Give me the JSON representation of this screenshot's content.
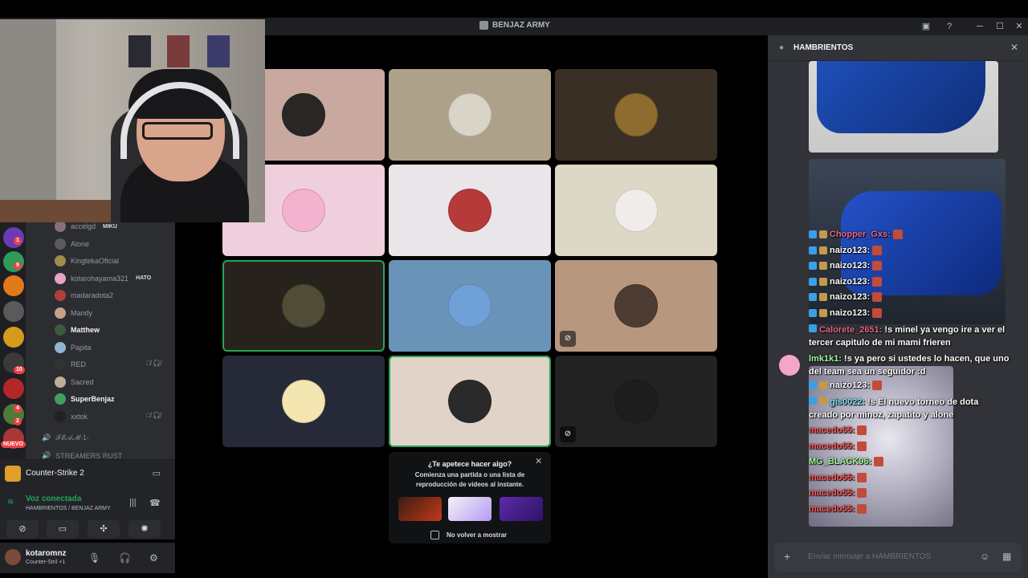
{
  "window": {
    "title": "BENJAZ ARMY"
  },
  "members": [
    {
      "name": "accelgd",
      "tag": "MIKU",
      "color": "#8a6f7a"
    },
    {
      "name": "Alone",
      "tag": "",
      "color": "#5b5b5b"
    },
    {
      "name": "KingtekaOficial",
      "tag": "",
      "color": "#a08a50"
    },
    {
      "name": "kotarohayama321",
      "tag": "HATO",
      "color": "#e7a3c4"
    },
    {
      "name": "madaradota2",
      "tag": "",
      "color": "#b0403a"
    },
    {
      "name": "Mandy",
      "tag": "",
      "color": "#c7a18a"
    },
    {
      "name": "Matthew",
      "tag": "",
      "color": "#3d5a3f"
    },
    {
      "name": "Papita",
      "tag": "",
      "color": "#8fb4d4"
    },
    {
      "name": "RED",
      "tag": "",
      "color": "#333"
    },
    {
      "name": "Sacred",
      "tag": "",
      "color": "#c2ad98"
    },
    {
      "name": "SuperBenjaz",
      "tag": "",
      "color": "#40a060"
    },
    {
      "name": "xxtok",
      "tag": "",
      "color": "#222"
    }
  ],
  "voice_channels": [
    "𝓣𝓔𝓐𝓜-1-",
    "STREAMERS RUST"
  ],
  "rail_badges": [
    "1",
    "9",
    "10",
    "4",
    "2"
  ],
  "nuevo": "NUEVO",
  "activity": {
    "game": "Counter-Strike 2"
  },
  "voice": {
    "status": "Voz conectada",
    "channel": "HAMBRIENTOS / BENJAZ ARMY"
  },
  "user": {
    "name": "kotaromnz",
    "status": "Counter-Stril +1"
  },
  "tiles_colors": [
    "#c9a8a0",
    "#aea189",
    "#3a2f25",
    "#efcfdc",
    "#e9e5e8",
    "#dcd8c5",
    "#27231c",
    "#6a93b8",
    "#b7987e",
    "#262938",
    "#e1d3c7",
    "#222222"
  ],
  "avatar_colors": [
    "#2a2626",
    "#d9d4c8",
    "#8e6b2f",
    "#f3b3cf",
    "#b53a3a",
    "#f0ecea",
    "#4f4d35",
    "#6fa0d8",
    "#4d3c33",
    "#f4e6b0",
    "#2a2a2a",
    "#1d1d1d"
  ],
  "promo": {
    "title": "¿Te apetece hacer algo?",
    "subtitle": "Comienza una partida o una lista de reproducción de vídeos al instante.",
    "checkbox": "No volver a mostrar"
  },
  "chat": {
    "title": "HAMBRIENTOS",
    "placeholder": "Enviar mensaje a HAMBRIENTOS",
    "overlay": [
      {
        "name": "Chopper_Gxs:",
        "cls": "n1",
        "text": ""
      },
      {
        "name": "naizo123:",
        "cls": "",
        "text": ""
      },
      {
        "name": "naizo123:",
        "cls": "",
        "text": ""
      },
      {
        "name": "naizo123:",
        "cls": "",
        "text": ""
      },
      {
        "name": "naizo123:",
        "cls": "",
        "text": ""
      },
      {
        "name": "naizo123:",
        "cls": "",
        "text": ""
      }
    ],
    "msg_calorete": {
      "name": "Calorete_2651:",
      "text": "!s minel ya vengo ire a ver el tercer capitulo de mi mami frieren"
    },
    "msg_lmk": {
      "name": "lmk1k1:",
      "text": "!s ya pero si ustedes lo hacen, que uno del team sea un seguidor :d"
    },
    "msg_naizo": {
      "name": "naizo123:",
      "text": ""
    },
    "msg_torneo": {
      "name": "gis0022:",
      "text": "!s El nuevo torneo de dota creado por minoz, zapatito y alone"
    },
    "tail": [
      {
        "name": "macedo55:",
        "cls": "n5"
      },
      {
        "name": "macedo55:",
        "cls": "n5"
      },
      {
        "name": "MG_BLACK96:",
        "cls": "n4"
      },
      {
        "name": "macedo55:",
        "cls": "n5"
      },
      {
        "name": "macedo55:",
        "cls": "n5"
      },
      {
        "name": "macedo55:",
        "cls": "n5"
      }
    ]
  },
  "icons": {
    "pin": "✎",
    "help": "?",
    "minimize": "─",
    "maximize": "☐",
    "close": "✕",
    "mic": "🎙",
    "headset": "🎧",
    "gear": "⚙",
    "plus": "+",
    "emoji": "☺",
    "apps": "▦",
    "chat": "💬",
    "muted": "🔇",
    "speaker": "🔊",
    "signal": "📶"
  }
}
